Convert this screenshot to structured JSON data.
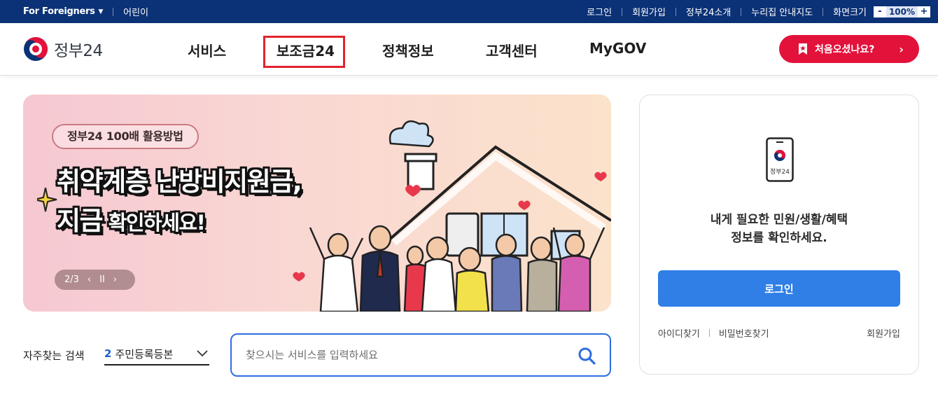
{
  "topbar": {
    "foreigners": "For Foreigners",
    "kids": "어린이",
    "links": [
      "로그인",
      "회원가입",
      "정부24소개",
      "누리집 안내지도"
    ],
    "zoom_label": "화면크기",
    "zoom_minus": "-",
    "zoom_value": "100%",
    "zoom_plus": "+"
  },
  "header": {
    "logo_text": "정부24",
    "menu": [
      "서비스",
      "보조금24",
      "정책정보",
      "고객센터",
      "MyGOV"
    ],
    "cta_label": "처음오셨나요?",
    "cta_arrow": "›"
  },
  "banner": {
    "pill": "정부24 100배 활용방법",
    "headline_1": "취약계층 난방비지원금,",
    "headline_2a": "지금",
    "headline_2b": " 확인하세요!",
    "page_indicator": "2/3",
    "prev": "‹",
    "pause": "II",
    "next": "›"
  },
  "search": {
    "frequent_label": "자주찾는 검색",
    "frequent_rank": "2",
    "frequent_term": "주민등록등본",
    "placeholder": "찾으시는 서비스를 입력하세요"
  },
  "login_card": {
    "device_text": "정부24",
    "message_1": "내게 필요한 민원/생활/혜택",
    "message_2": "정보를 확인하세요.",
    "login_button": "로그인",
    "find_id": "아이디찾기",
    "find_pw": "비밀번호찾기",
    "join": "회원가입"
  },
  "colors": {
    "topbar_bg": "#0b3176",
    "cta_bg": "#e3123b",
    "highlight_border": "#e0242e",
    "login_button_bg": "#2f7fe6",
    "search_border": "#2d6de0"
  }
}
